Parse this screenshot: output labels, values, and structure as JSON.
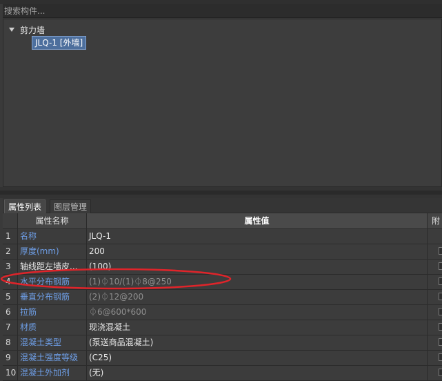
{
  "search": {
    "placeholder": "搜索构件..."
  },
  "tree": {
    "root_label": "剪力墙",
    "child_label": "JLQ-1 [外墙]"
  },
  "tabs": [
    {
      "label": "属性列表"
    },
    {
      "label": "图层管理"
    }
  ],
  "grid": {
    "headers": {
      "name": "属性名称",
      "value": "属性值",
      "attach": "附"
    },
    "rows": [
      {
        "index": "1",
        "name": "名称",
        "value": "JLQ-1"
      },
      {
        "index": "2",
        "name": "厚度(mm)",
        "value": "200"
      },
      {
        "index": "3",
        "name": "轴线距左墙皮...",
        "value": "(100)"
      },
      {
        "index": "4",
        "name": "水平分布钢筋",
        "value": "(1)⏀10/(1)⏀8@250"
      },
      {
        "index": "5",
        "name": "垂直分布钢筋",
        "value": "(2)⏀12@200"
      },
      {
        "index": "6",
        "name": "拉筋",
        "value": "⏀6@600*600"
      },
      {
        "index": "7",
        "name": "材质",
        "value": "现浇混凝土"
      },
      {
        "index": "8",
        "name": "混凝土类型",
        "value": "(泵送商品混凝土)"
      },
      {
        "index": "9",
        "name": "混凝土强度等级",
        "value": "(C25)"
      },
      {
        "index": "10",
        "name": "混凝土外加剂",
        "value": "(无)"
      }
    ]
  },
  "colors": {
    "accent_blue": "#6e9ee6",
    "annotation_red": "#e0242a",
    "selection": "#4d6f9d"
  }
}
